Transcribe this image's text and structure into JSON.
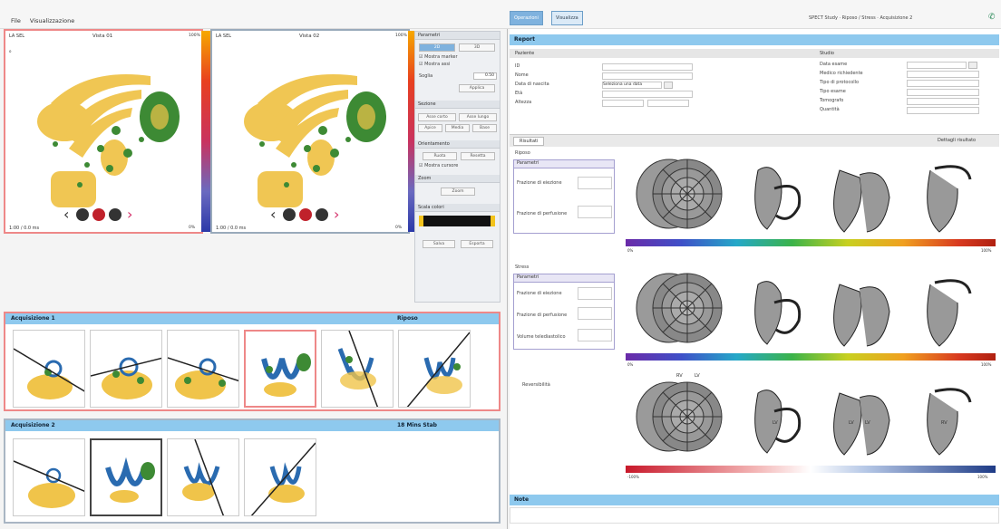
{
  "menu": [
    "File",
    "Visualizzazione"
  ],
  "header": {
    "tabs": [
      "Operazioni",
      "Visualizza"
    ],
    "status_text": "SPECT Study · Riposo / Stress · Acquisizione 2",
    "colors": {
      "accent": "#8ec9ee",
      "active_tab": "#7fb2de",
      "selection": "#e88888"
    }
  },
  "viewer": {
    "left_panel": {
      "tl": "LA SEL",
      "title": "Vista 01",
      "pct_top": "100%",
      "pct_bottom": "0%",
      "bottom_left": "1:00 / 0.0 ms"
    },
    "right_panel": {
      "tl": "LA SEL",
      "title": "Vista 02",
      "pct_top": "100%",
      "pct_bottom": "0%",
      "bottom_left": "1:00 / 0.0 ms"
    },
    "nav": {
      "prev": "‹",
      "next": "›"
    }
  },
  "controls": {
    "section1": "Parametri",
    "tabs": [
      "2D",
      "3D"
    ],
    "checks": [
      "Mostra marker",
      "Mostra assi"
    ],
    "field_label": "Soglia",
    "field_value": "0.50",
    "apply_btn": "Applica",
    "section2": "Sezione",
    "btns_row1": [
      "Asse corto",
      "Asse lungo"
    ],
    "btns_row2": [
      "Apice",
      "Media",
      "Base"
    ],
    "section3": "Orientamento",
    "btns_row3": [
      "Ruota",
      "Resetta"
    ],
    "check3": "Mostra cursore",
    "section4": "Zoom",
    "zoom_btn": "Zoom",
    "section5": "Scala colori",
    "bottom_btns": [
      "Salva",
      "Esporta"
    ]
  },
  "acq1": {
    "title": "Acquisizione 1",
    "right_label": "Riposo"
  },
  "acq2": {
    "title": "Acquisizione 2",
    "right_label": "18 Mins Stab"
  },
  "report": {
    "title": "Report",
    "patient_header": "Paziente",
    "study_header": "Studio",
    "left_labels": [
      "ID",
      "Nome",
      "Data di nascita",
      "Età",
      "Altezza"
    ],
    "left_values": [
      "",
      "",
      "",
      "",
      ""
    ],
    "date_btn": "Seleziona una data",
    "right_labels": [
      "Data esame",
      "Medico richiedente",
      "Tipo di protocollo",
      "Tipo esame",
      "Tomografo",
      "Quantità"
    ],
    "right_values": [
      "",
      "",
      "",
      "",
      "",
      ""
    ]
  },
  "results": {
    "tab": "Risultati",
    "right_link": "Dettagli risultato",
    "section_rest": "Riposo",
    "section_stress": "Stress",
    "section_diff": "Reversibilità",
    "box_title": "Parametri",
    "rest_fields": [
      {
        "label": "Frazione di eiezione",
        "value": ""
      },
      {
        "label": "Frazione di perfusione",
        "value": ""
      }
    ],
    "stress_fields": [
      {
        "label": "Frazione di eiezione",
        "value": ""
      },
      {
        "label": "Frazione di perfusione",
        "value": ""
      },
      {
        "label": "Volume telediastolico",
        "value": ""
      }
    ],
    "scale_rest": {
      "min": "0%",
      "max": "100%"
    },
    "scale_stress": {
      "min": "0%",
      "max": "100%"
    },
    "scale_diff": {
      "min": "-100%",
      "max": "100%"
    },
    "bullseye_labels": [
      "RV",
      "LV"
    ],
    "segment_labels": [
      "LV",
      "LV",
      "LV",
      "RV"
    ]
  },
  "footer": {
    "label": "Note"
  }
}
